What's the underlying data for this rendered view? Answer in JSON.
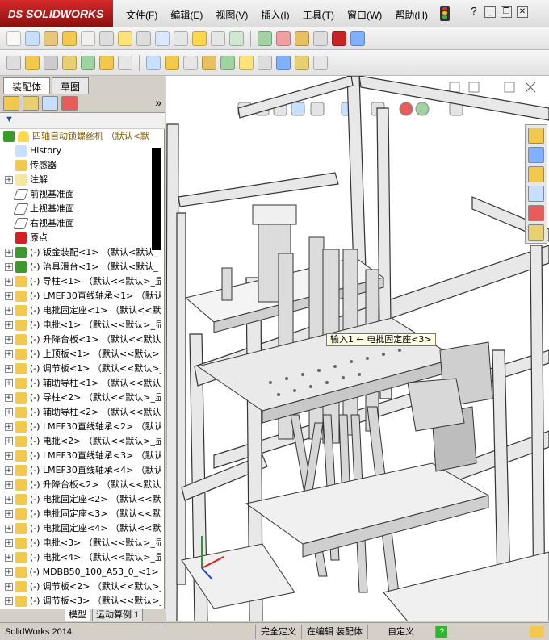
{
  "app": {
    "brand": "SOLIDWORKS",
    "brand_prefix": "DS"
  },
  "menu": [
    {
      "label": "文件(F)"
    },
    {
      "label": "编辑(E)"
    },
    {
      "label": "视图(V)"
    },
    {
      "label": "插入(I)"
    },
    {
      "label": "工具(T)"
    },
    {
      "label": "窗口(W)"
    },
    {
      "label": "帮助(H)"
    }
  ],
  "window_controls": {
    "help": "?",
    "minimize": "_",
    "restore": "❐",
    "close": "✕"
  },
  "panel": {
    "tabs": [
      {
        "label": "装配体"
      },
      {
        "label": "草图"
      }
    ],
    "collapse": "»",
    "filter": "▼"
  },
  "tree": {
    "root": "四轴自动锁螺丝机  （默认<默",
    "items": [
      {
        "label": "History",
        "icon": "history-icon",
        "exp": ""
      },
      {
        "label": "传感器",
        "icon": "sensor-icon",
        "exp": ""
      },
      {
        "label": "注解",
        "icon": "annotation-icon",
        "exp": "+"
      },
      {
        "label": "前视基准面",
        "icon": "plane-icon",
        "exp": ""
      },
      {
        "label": "上视基准面",
        "icon": "plane-icon",
        "exp": ""
      },
      {
        "label": "右视基准面",
        "icon": "plane-icon",
        "exp": ""
      },
      {
        "label": "原点",
        "icon": "origin-icon",
        "exp": ""
      },
      {
        "label": "(-) 钣金装配<1> （默认<默认_",
        "icon": "assembly-icon",
        "exp": "+"
      },
      {
        "label": "(-) 治具滑台<1> （默认<默认_",
        "icon": "assembly-icon",
        "exp": "+"
      },
      {
        "label": "(-) 导柱<1> （默认<<默认>_显",
        "icon": "part-icon",
        "exp": "+"
      },
      {
        "label": "(-) LMEF30直线轴承<1> （默认",
        "icon": "part-icon",
        "exp": "+"
      },
      {
        "label": "(-) 电批固定座<1> （默认<<默",
        "icon": "part-icon",
        "exp": "+"
      },
      {
        "label": "(-) 电批<1> （默认<<默认>_显",
        "icon": "part-icon",
        "exp": "+"
      },
      {
        "label": "(-) 升降台板<1> （默认<<默认",
        "icon": "part-icon",
        "exp": "+"
      },
      {
        "label": "(-) 上顶板<1> （默认<<默认>",
        "icon": "part-icon",
        "exp": "+"
      },
      {
        "label": "(-) 调节板<1> （默认<<默认>_",
        "icon": "part-icon",
        "exp": "+"
      },
      {
        "label": "(-) 辅助导柱<1> （默认<<默认",
        "icon": "part-icon",
        "exp": "+"
      },
      {
        "label": "(-) 导柱<2> （默认<<默认>_显",
        "icon": "part-icon",
        "exp": "+"
      },
      {
        "label": "(-) 辅助导柱<2> （默认<<默认",
        "icon": "part-icon",
        "exp": "+"
      },
      {
        "label": "(-) LMEF30直线轴承<2> （默认",
        "icon": "part-icon",
        "exp": "+"
      },
      {
        "label": "(-) 电批<2> （默认<<默认>_显",
        "icon": "part-icon",
        "exp": "+"
      },
      {
        "label": "(-) LMEF30直线轴承<3> （默认",
        "icon": "part-icon",
        "exp": "+"
      },
      {
        "label": "(-) LMEF30直线轴承<4> （默认",
        "icon": "part-icon",
        "exp": "+"
      },
      {
        "label": "(-) 升降台板<2> （默认<<默认",
        "icon": "part-icon",
        "exp": "+"
      },
      {
        "label": "(-) 电批固定座<2> （默认<<默",
        "icon": "part-icon",
        "exp": "+"
      },
      {
        "label": "(-) 电批固定座<3> （默认<<默",
        "icon": "part-icon",
        "exp": "+"
      },
      {
        "label": "(-) 电批固定座<4> （默认<<默",
        "icon": "part-icon",
        "exp": "+"
      },
      {
        "label": "(-) 电批<3> （默认<<默认>_显",
        "icon": "part-icon",
        "exp": "+"
      },
      {
        "label": "(-) 电批<4> （默认<<默认>_显",
        "icon": "part-icon",
        "exp": "+"
      },
      {
        "label": "(-) MDBB50_100_A53_0_<1> （默",
        "icon": "part-icon",
        "exp": "+"
      },
      {
        "label": "(-) 调节板<2> （默认<<默认>_",
        "icon": "part-icon",
        "exp": "+"
      },
      {
        "label": "(-) 调节板<3> （默认<<默认>_",
        "icon": "part-icon",
        "exp": "+"
      }
    ]
  },
  "viewport": {
    "callout": "输入1  ← 电批固定座<3>"
  },
  "bottom_tabs": [
    {
      "label": "模型"
    },
    {
      "label": "运动算例 1"
    }
  ],
  "status": {
    "app_version": "SolidWorks 2014",
    "definition": "完全定义",
    "mode": "在编辑 装配体",
    "units": "自定义",
    "help": "?"
  },
  "colors": {
    "brand_red": "#c41f1f",
    "tree_folder": "#d9a400",
    "assembly_green": "#3a9a2a"
  }
}
